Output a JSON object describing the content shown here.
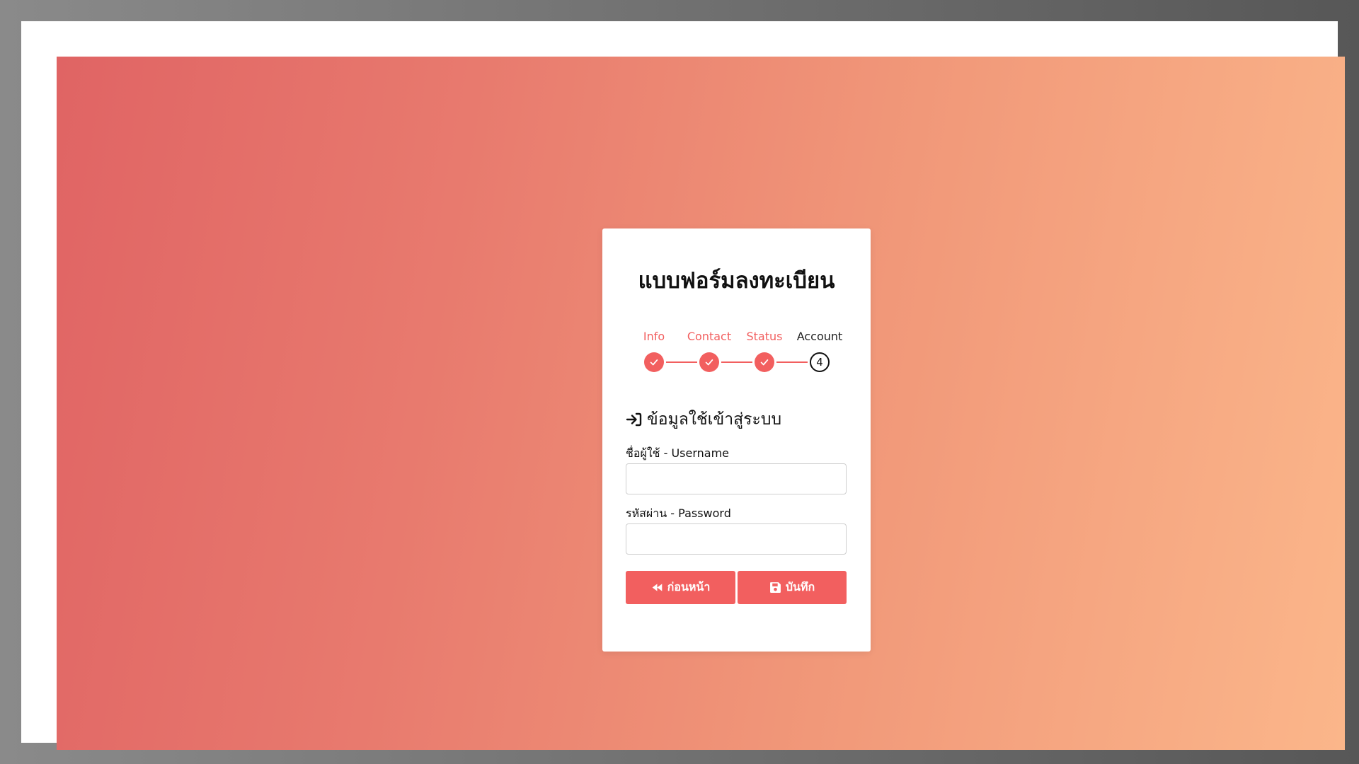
{
  "form": {
    "title": "แบบฟอร์มลงทะเบียน",
    "steps": [
      {
        "label": "Info",
        "state": "done"
      },
      {
        "label": "Contact",
        "state": "done"
      },
      {
        "label": "Status",
        "state": "done"
      },
      {
        "label": "Account",
        "state": "current",
        "number": "4"
      }
    ],
    "section_title": "ข้อมูลใช้เข้าสู่ระบบ",
    "section_icon": "sign-in-icon",
    "username_label": "ชื่อผู้ใช้ - Username",
    "username_value": "",
    "password_label": "รหัสผ่าน - Password",
    "password_value": "",
    "back_button": "ก่อนหน้า",
    "back_icon": "backward-icon",
    "save_button": "บันทึก",
    "save_icon": "save-icon"
  },
  "colors": {
    "accent": "#f25f5f",
    "background_start": "#e06464",
    "background_end": "#fbb68a",
    "card": "#ffffff"
  }
}
